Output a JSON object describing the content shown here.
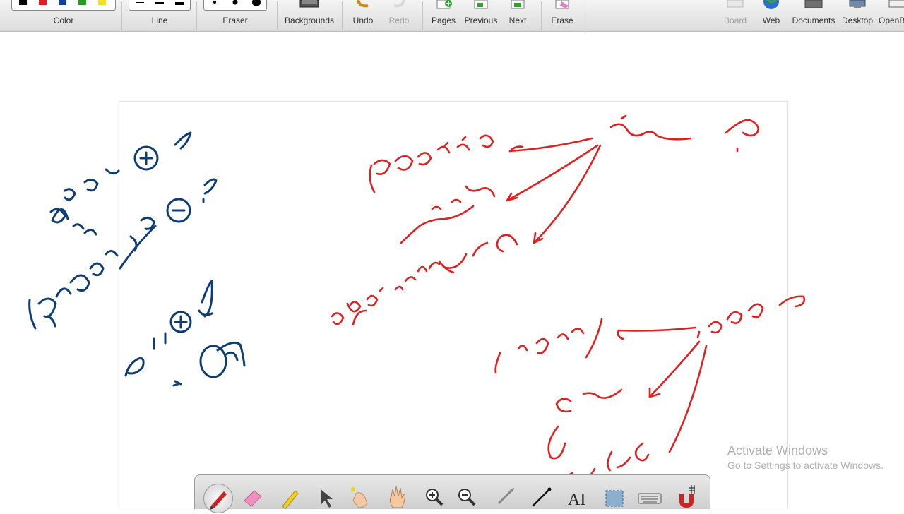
{
  "toolbar": {
    "color_label": "Color",
    "line_label": "Line",
    "eraser_label": "Eraser",
    "backgrounds_label": "Backgrounds",
    "undo_label": "Undo",
    "redo_label": "Redo",
    "pages_label": "Pages",
    "previous_label": "Previous",
    "next_label": "Next",
    "erase_label": "Erase",
    "board_label": "Board",
    "web_label": "Web",
    "documents_label": "Documents",
    "desktop_label": "Desktop",
    "openboard_label": "OpenBo"
  },
  "colors": {
    "swatches": [
      "#000000",
      "#e02020",
      "#1040a0",
      "#20a020",
      "#f0e020"
    ],
    "ink_red": "#e02020",
    "ink_blue": "#0d3d75"
  },
  "icons": {
    "backgrounds": "backgrounds-icon",
    "undo": "undo-icon",
    "redo": "redo-icon",
    "pages": "add-page-icon",
    "previous": "previous-page-icon",
    "next": "next-page-icon",
    "erase": "erase-page-icon",
    "board": "board-icon",
    "web": "globe-icon",
    "documents": "folder-icon",
    "desktop": "monitor-icon"
  },
  "dock": {
    "tools": [
      "pen-icon",
      "eraser-icon",
      "marker-icon",
      "pointer-icon",
      "laser-icon",
      "hand-icon",
      "zoom-in-icon",
      "zoom-out-icon",
      "pointer-tool-icon",
      "line-icon",
      "text-icon",
      "capture-icon",
      "keyboard-icon",
      "magnet-icon"
    ],
    "text_tool_glyph": "AI"
  },
  "watermark": {
    "title": "Activate Windows",
    "subtitle": "Go to Settings to activate Windows."
  }
}
